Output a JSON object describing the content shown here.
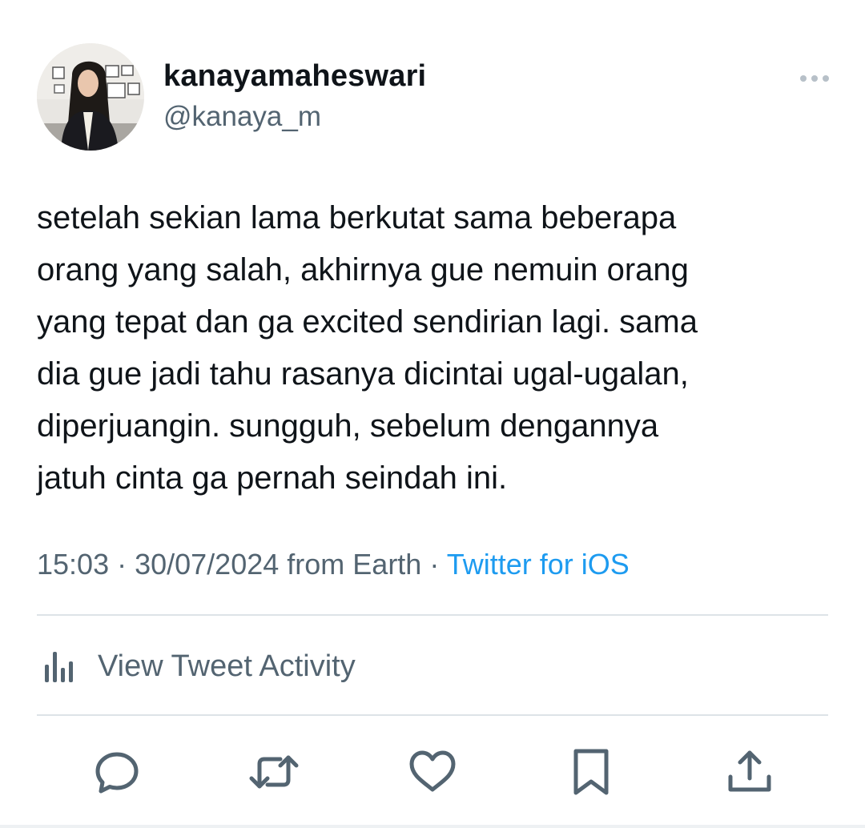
{
  "author": {
    "display_name": "kanayamaheswari",
    "handle": "@kanaya_m",
    "avatar_icon": "profile-photo"
  },
  "tweet": {
    "text": "setelah sekian lama berkutat sama beberapa\norang yang salah, akhirnya gue nemuin orang\nyang tepat dan ga excited sendirian lagi. sama\ndia gue jadi tahu rasanya dicintai ugal-ugalan,\ndiperjuangin. sungguh, sebelum dengannya\njatuh cinta ga pernah seindah ini."
  },
  "meta": {
    "time": "15:03",
    "separator": " · ",
    "date": "30/07/2024",
    "location": " from Earth",
    "separator2": " · ",
    "source": "Twitter for iOS"
  },
  "activity": {
    "label": "View Tweet Activity",
    "icon": "bar-chart-icon"
  },
  "actions": {
    "reply_icon": "reply-icon",
    "retweet_icon": "retweet-icon",
    "like_icon": "heart-icon",
    "bookmark_icon": "bookmark-icon",
    "share_icon": "share-icon"
  },
  "colors": {
    "text_primary": "#0f1419",
    "text_secondary": "#536471",
    "link": "#1d9bf0",
    "divider": "#dde3e7"
  }
}
